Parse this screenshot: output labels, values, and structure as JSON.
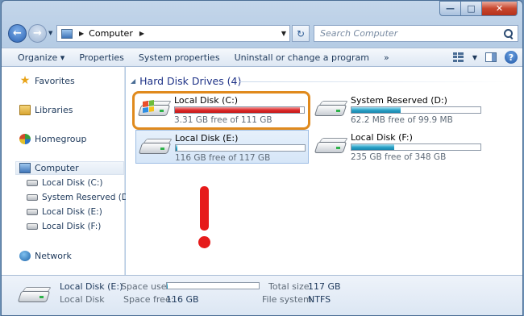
{
  "address": {
    "crumb": "Computer",
    "search_placeholder": "Search Computer"
  },
  "toolbar": {
    "organize": "Organize ▾",
    "properties": "Properties",
    "system_properties": "System properties",
    "uninstall": "Uninstall or change a program",
    "more": "»"
  },
  "sidebar": {
    "favorites": "Favorites",
    "libraries": "Libraries",
    "homegroup": "Homegroup",
    "computer": "Computer",
    "disk_c": "Local Disk (C:)",
    "disk_d": "System Reserved (D:)",
    "disk_e": "Local Disk (E:)",
    "disk_f": "Local Disk (F:)",
    "network": "Network"
  },
  "group": {
    "title": "Hard Disk Drives (4)"
  },
  "drives": [
    {
      "name": "Local Disk (C:)",
      "free": "3.31 GB free of 111 GB",
      "used_fraction": 0.97,
      "color": "#dd2a2a"
    },
    {
      "name": "System Reserved (D:)",
      "free": "62.2 MB free of 99.9 MB",
      "used_fraction": 0.38,
      "color": "#2ba3c8"
    },
    {
      "name": "Local Disk (E:)",
      "free": "116 GB free of 117 GB",
      "used_fraction": 0.01,
      "color": "#2ba3c8"
    },
    {
      "name": "Local Disk (F:)",
      "free": "235 GB free of 348 GB",
      "used_fraction": 0.33,
      "color": "#2ba3c8"
    }
  ],
  "details": {
    "name": "Local Disk (E:)",
    "type": "Local Disk",
    "space_used_label": "Space used:",
    "space_free_label": "Space free:",
    "space_free": "116 GB",
    "total_size_label": "Total size:",
    "total_size": "117 GB",
    "file_system_label": "File system:",
    "file_system": "NTFS",
    "used_fraction": 0.01
  }
}
